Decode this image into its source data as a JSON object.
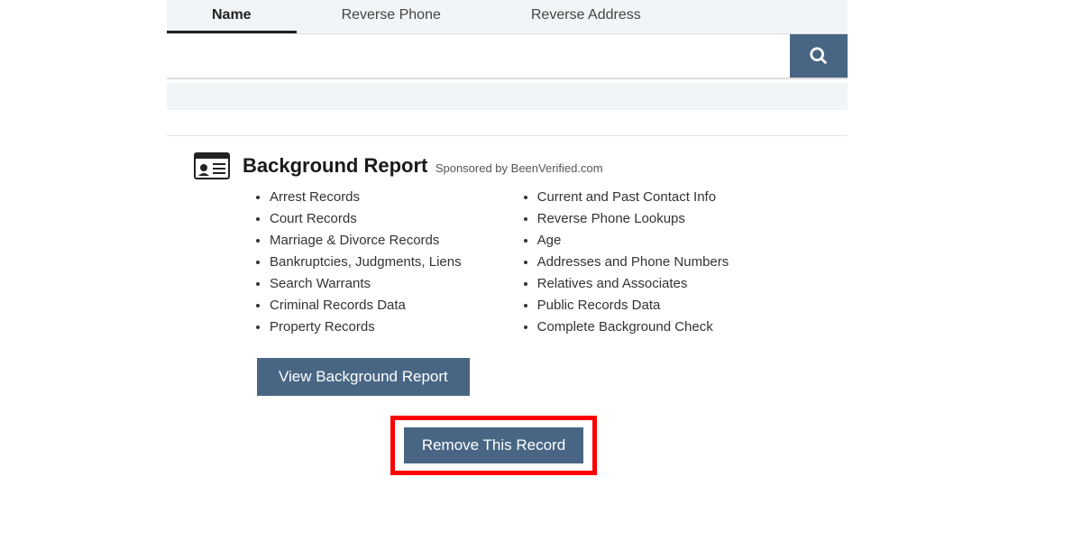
{
  "tabs": {
    "name": "Name",
    "reversePhone": "Reverse Phone",
    "reverseAddress": "Reverse Address"
  },
  "search": {
    "placeholder": ""
  },
  "report": {
    "title": "Background Report",
    "sponsored": "Sponsored by BeenVerified.com",
    "leftItems": [
      "Arrest Records",
      "Court Records",
      "Marriage & Divorce Records",
      "Bankruptcies, Judgments, Liens",
      "Search Warrants",
      "Criminal Records Data",
      "Property Records"
    ],
    "rightItems": [
      "Current and Past Contact Info",
      "Reverse Phone Lookups",
      "Age",
      "Addresses and Phone Numbers",
      "Relatives and Associates",
      "Public Records Data",
      "Complete Background Check"
    ],
    "viewButton": "View Background Report"
  },
  "removeButton": "Remove This Record"
}
